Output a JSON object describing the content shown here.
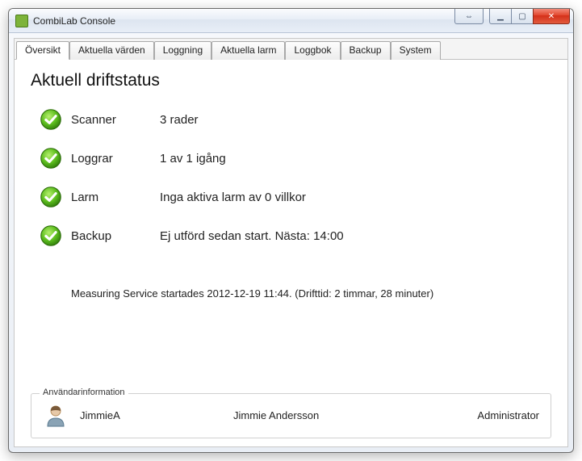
{
  "window": {
    "title": "CombiLab Console"
  },
  "tabs": [
    {
      "label": "Översikt",
      "active": true
    },
    {
      "label": "Aktuella värden",
      "active": false
    },
    {
      "label": "Loggning",
      "active": false
    },
    {
      "label": "Aktuella larm",
      "active": false
    },
    {
      "label": "Loggbok",
      "active": false
    },
    {
      "label": "Backup",
      "active": false
    },
    {
      "label": "System",
      "active": false
    }
  ],
  "page": {
    "title": "Aktuell driftstatus",
    "rows": [
      {
        "label": "Scanner",
        "value": "3 rader"
      },
      {
        "label": "Loggrar",
        "value": "1 av 1 igång"
      },
      {
        "label": "Larm",
        "value": "Inga aktiva larm av 0 villkor"
      },
      {
        "label": "Backup",
        "value": "Ej utförd sedan start. Nästa: 14:00"
      }
    ],
    "info": "Measuring Service startades 2012-12-19 11:44.  (Drifttid: 2 timmar, 28 minuter)"
  },
  "user": {
    "legend": "Användarinformation",
    "username": "JimmieA",
    "fullname": "Jimmie Andersson",
    "role": "Administrator"
  },
  "glyphs": {
    "navArrows": "⇔",
    "min": "▁",
    "max": "▢",
    "close": "✕"
  }
}
